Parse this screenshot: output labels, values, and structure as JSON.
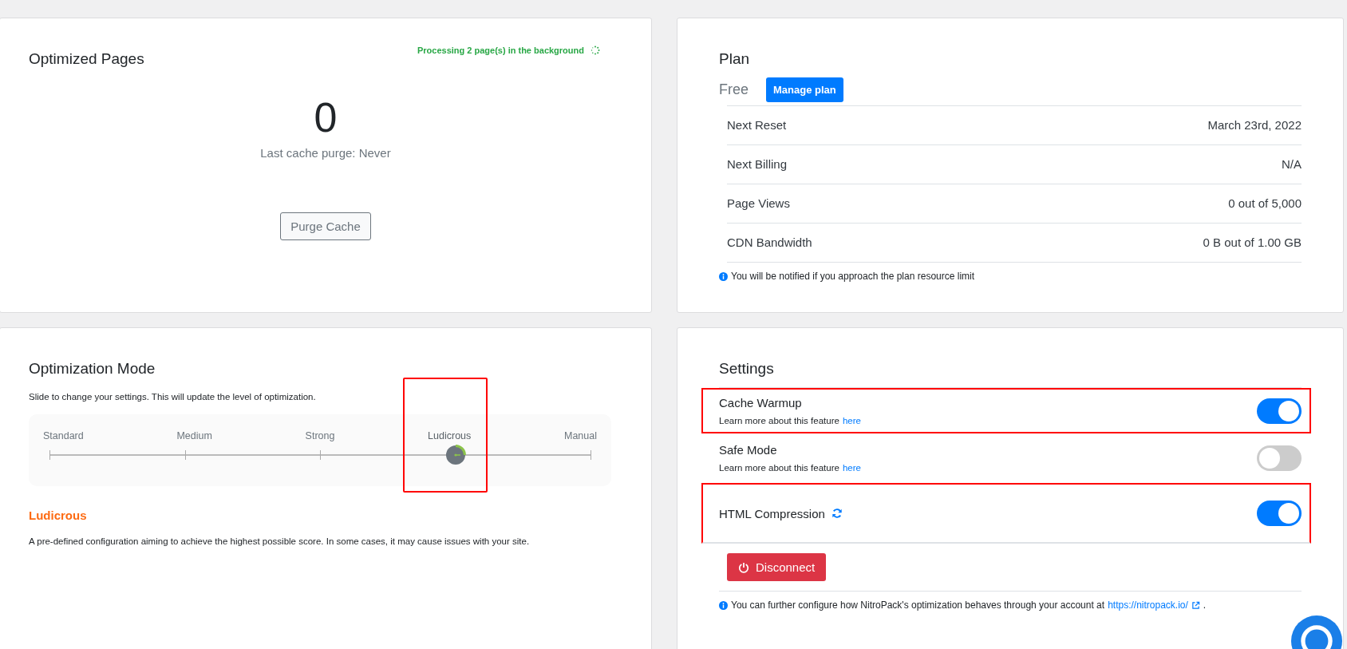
{
  "optimized_pages": {
    "title": "Optimized Pages",
    "status": "Processing 2 page(s) in the background",
    "count": "0",
    "last_purge": "Last cache purge: Never",
    "button": "Purge Cache"
  },
  "plan": {
    "title": "Plan",
    "name": "Free",
    "button": "Manage plan",
    "rows": [
      {
        "label": "Next Reset",
        "value": "March 23rd, 2022"
      },
      {
        "label": "Next Billing",
        "value": "N/A"
      },
      {
        "label": "Page Views",
        "value": "0 out of 5,000"
      },
      {
        "label": "CDN Bandwidth",
        "value": "0 B out of 1.00 GB"
      }
    ],
    "note": "You will be notified if you approach the plan resource limit"
  },
  "optimization_mode": {
    "title": "Optimization Mode",
    "description": "Slide to change your settings. This will update the level of optimization.",
    "slider": {
      "level": 0.75,
      "highlighted": true,
      "stops": [
        {
          "label": "Standard",
          "selected": false
        },
        {
          "label": "Medium",
          "selected": false
        },
        {
          "label": "Strong",
          "selected": false
        },
        {
          "label": "Ludicrous",
          "selected": true
        },
        {
          "label": "Manual",
          "selected": false
        }
      ]
    },
    "mode_name": "Ludicrous",
    "mode_description": "A pre-defined configuration aiming to achieve the highest possible score. In some cases, it may cause issues with your site."
  },
  "settings": {
    "title": "Settings",
    "items": [
      {
        "label": "Cache Warmup",
        "hint": "Learn more about this feature",
        "link": "here",
        "on": true,
        "highlighted": true,
        "refresh": false
      },
      {
        "label": "Safe Mode",
        "hint": "Learn more about this feature",
        "link": "here",
        "on": false,
        "highlighted": false,
        "refresh": false
      },
      {
        "label": "HTML Compression",
        "on": true,
        "highlighted": true,
        "refresh": true
      }
    ],
    "button": "Disconnect",
    "note": "You can further configure how NitroPack's optimization behaves through your account at",
    "note_link": "https://nitropack.io/",
    "note_end": "."
  }
}
